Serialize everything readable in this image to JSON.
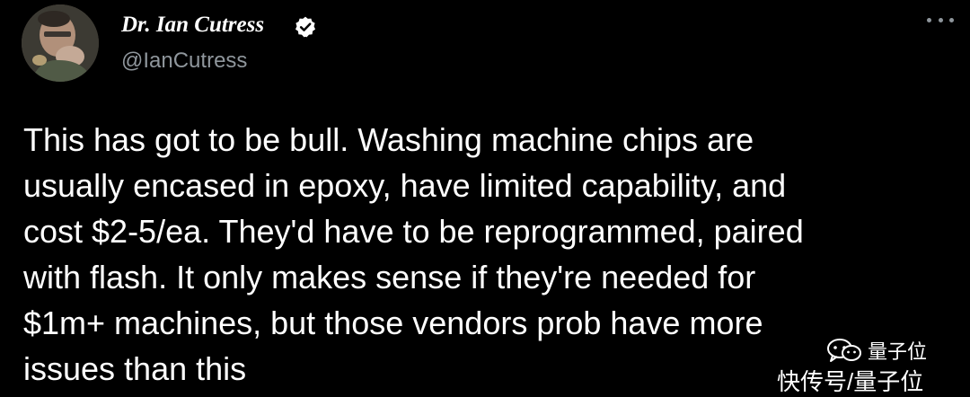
{
  "author": {
    "name": "Dr. Ian Cutress",
    "handle": "@IanCutress",
    "verified": true,
    "avatar": "avatar-photo"
  },
  "menu": {
    "icon": "more-options-icon"
  },
  "tweet": {
    "lines": [
      "This has got to be bull. Washing machine chips are",
      "usually encased in epoxy, have limited capability, and",
      "cost $2-5/ea. They'd have to be reprogrammed, paired",
      "with flash. It only makes sense if they're needed for",
      "$1m+ machines, but those vendors prob have more",
      "issues than this"
    ]
  },
  "watermark": {
    "icon": "wechat-icon",
    "account_name": "量子位",
    "credit": "快传号/量子位"
  },
  "colors": {
    "background": "#000000",
    "text": "#ffffff",
    "secondary_text": "#8f969c"
  }
}
